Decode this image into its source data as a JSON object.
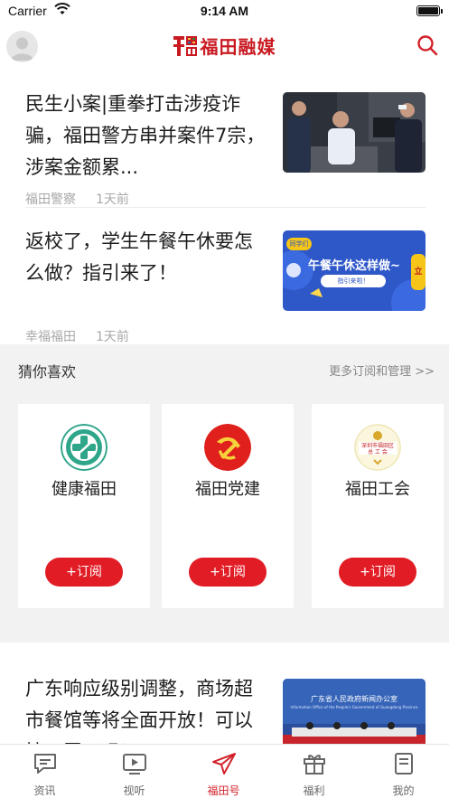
{
  "status_bar": {
    "carrier": "Carrier",
    "time": "9:14 AM"
  },
  "header": {
    "logo_text": "福田融媒",
    "search_icon": "search-icon",
    "accent": "#d2212a"
  },
  "news": [
    {
      "title": "民生小案|重拳打击涉疫诈骗，福田警方串并案件7宗，涉案金额累...",
      "source": "福田警察",
      "time": "1天前"
    },
    {
      "title": "返校了，学生午餐午休要怎么做？指引来了！",
      "source": "幸福福田",
      "time": "1天前",
      "thumb": {
        "tag": "同学们",
        "headline": "午餐午休这样做~",
        "button": "指引来啦！",
        "side": "立"
      }
    },
    {
      "title": "广东响应级别调整，商场超市餐馆等将全面开放！可以摘口罩了吗？",
      "thumb": {
        "line1": "广东省人民政府新闻办公室",
        "line2": "Information Office of the People's Government of Guangdong Province"
      }
    }
  ],
  "recommend": {
    "title": "猜你喜欢",
    "more": "更多订阅和管理 >>",
    "cards": [
      {
        "name": "健康福田",
        "button": "+订阅",
        "icon": "health-cross-icon"
      },
      {
        "name": "福田党建",
        "button": "+订阅",
        "icon": "party-emblem-icon"
      },
      {
        "name": "福田工会",
        "button": "+订阅",
        "icon": "union-emblem-icon",
        "badge_line1": "深圳市福田区",
        "badge_line2": "总 工 会"
      }
    ]
  },
  "tabs": [
    {
      "label": "资讯",
      "icon": "news-chat-icon",
      "active": false
    },
    {
      "label": "视听",
      "icon": "video-play-icon",
      "active": false
    },
    {
      "label": "福田号",
      "icon": "paper-plane-icon",
      "active": true
    },
    {
      "label": "福利",
      "icon": "gift-icon",
      "active": false
    },
    {
      "label": "我的",
      "icon": "profile-doc-icon",
      "active": false
    }
  ]
}
